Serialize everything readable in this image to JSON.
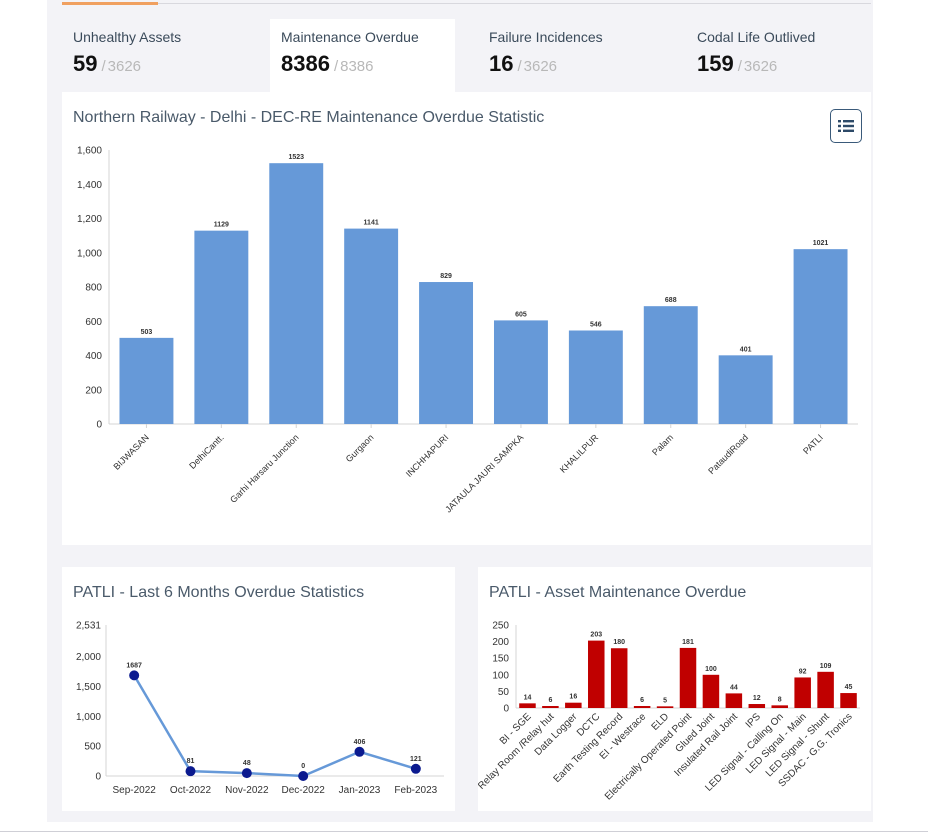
{
  "summary_cards": [
    {
      "label": "Unhealthy Assets",
      "value": "59",
      "separator": "/",
      "total": "3626"
    },
    {
      "label": "Maintenance Overdue",
      "value": "8386",
      "separator": "/",
      "total": "8386"
    },
    {
      "label": "Failure Incidences",
      "value": "16",
      "separator": "/",
      "total": "3626"
    },
    {
      "label": "Codal Life Outlived",
      "value": "159",
      "separator": "/",
      "total": "3626"
    }
  ],
  "main_panel": {
    "title": "Northern Railway - Delhi - DEC-RE Maintenance Overdue Statistic",
    "menu_icon": "list-menu-icon"
  },
  "trend_panel": {
    "title": "PATLI - Last 6 Months Overdue Statistics"
  },
  "asset_panel": {
    "title": "PATLI - Asset Maintenance Overdue"
  },
  "colors": {
    "bar_blue": "#6699d8",
    "line_blue": "#6699d8",
    "point_navy": "#0b1a8f",
    "bar_red": "#c00000"
  },
  "chart_data": [
    {
      "type": "bar",
      "title": "Northern Railway - Delhi - DEC-RE Maintenance Overdue Statistic",
      "categories": [
        "BIJWASAN",
        "DelhiCantt.",
        "Garhi Harsaru Junction",
        "Gurgaon",
        "INCHHAPURI",
        "JATAULA JAURI SAMPKA",
        "KHALILPUR",
        "Palam",
        "PataudiRoad",
        "PATLI"
      ],
      "values": [
        503,
        1129,
        1523,
        1141,
        829,
        605,
        546,
        688,
        401,
        1021
      ],
      "ylim": [
        0,
        1600
      ],
      "yticks": [
        "1,600",
        "1,400",
        "1,200",
        "1,000",
        "800",
        "600",
        "400",
        "200",
        "0"
      ],
      "grid": false,
      "data_labels": true
    },
    {
      "type": "line",
      "title": "PATLI - Last 6 Months Overdue Statistics",
      "categories": [
        "Sep-2022",
        "Oct-2022",
        "Nov-2022",
        "Dec-2022",
        "Jan-2023",
        "Feb-2023"
      ],
      "values": [
        1687,
        81,
        48,
        0,
        406,
        121
      ],
      "ylim": [
        0,
        2531
      ],
      "yticks": [
        "2,531",
        "2,000",
        "1,500",
        "1,000",
        "500",
        "0"
      ],
      "grid": false,
      "data_labels": true
    },
    {
      "type": "bar",
      "title": "PATLI - Asset Maintenance Overdue",
      "categories": [
        "BI - SGE",
        "Relay Room /Relay hut",
        "Data Logger",
        "DCTC",
        "Earth Testing Record",
        "EI - Westrace",
        "ELD",
        "Electrically Operated Point",
        "Glued Joint",
        "Insulated Rail Joint",
        "IPS",
        "LED Signal - Calling On",
        "LED Signal - Main",
        "LED Signal - Shunt",
        "SSDAC - G.G. Tronics"
      ],
      "values": [
        14,
        6,
        16,
        203,
        180,
        6,
        5,
        181,
        100,
        44,
        12,
        8,
        92,
        109,
        45
      ],
      "ylim": [
        0,
        250
      ],
      "yticks": [
        "250",
        "200",
        "150",
        "100",
        "50",
        "0"
      ],
      "grid": false,
      "data_labels": true
    }
  ]
}
